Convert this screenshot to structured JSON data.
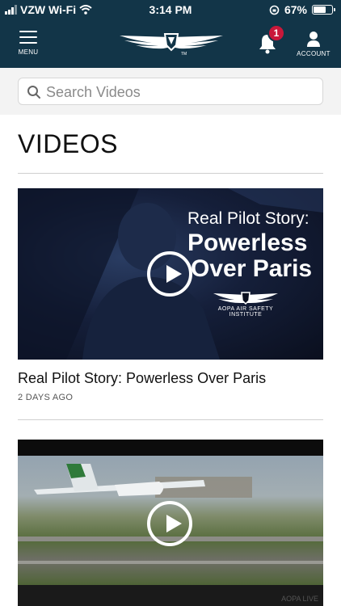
{
  "status_bar": {
    "carrier": "VZW Wi-Fi",
    "time": "3:14 PM",
    "battery": "67%",
    "battery_level": 0.67
  },
  "header": {
    "menu_label": "MENU",
    "account_label": "ACCOUNT",
    "notification_count": "1",
    "logo_tm": "TM"
  },
  "search": {
    "placeholder": "Search Videos"
  },
  "page": {
    "title": "VIDEOS"
  },
  "videos": [
    {
      "title": "Real Pilot Story: Powerless Over Paris",
      "age": "2 DAYS AGO",
      "overlay_line1": "Real Pilot Story:",
      "overlay_line2": "Powerless",
      "overlay_line3": "Over Paris",
      "overlay_brand": "AOPA AIR SAFETY INSTITUTE"
    },
    {
      "title": "",
      "age": "",
      "watermark": "AOPA LIVE"
    }
  ],
  "colors": {
    "nav_bg": "#123548",
    "badge": "#c9183a",
    "search_bg": "#f3f3f3"
  }
}
